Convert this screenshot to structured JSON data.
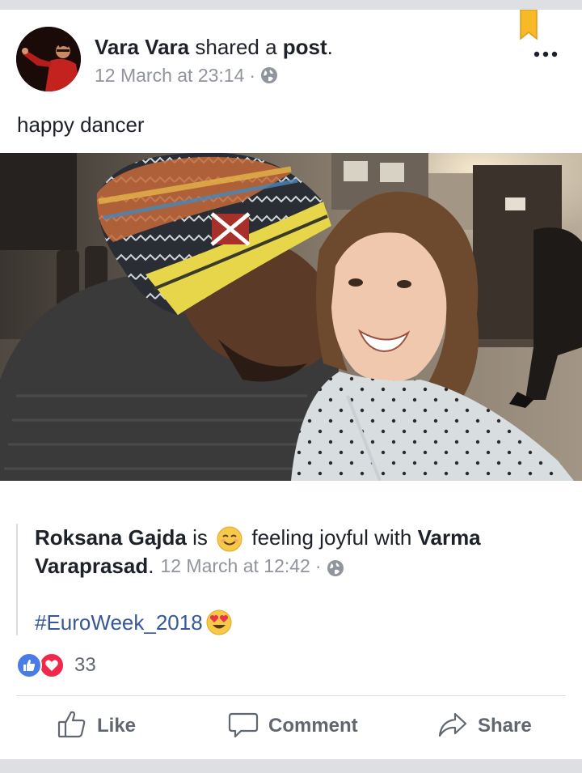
{
  "post": {
    "author": "Vara Vara",
    "action": "shared a",
    "object": "post",
    "period": ".",
    "timestamp": "12 March at 23:14",
    "separator": "·",
    "privacy_icon": "globe-icon",
    "caption": "happy dancer",
    "bookmark_icon": "bookmark-icon",
    "more_icon": "more-options-icon",
    "photo": "selfie-photo"
  },
  "shared_post": {
    "author": "Roksana Gajda",
    "is": "is",
    "feeling_emoji": "smiling-face-emoji",
    "feeling_text": "feeling joyful with",
    "tagged_line1": "Varma",
    "tagged_line2": "Varaprasad",
    "period": ".",
    "timestamp": "12 March at 12:42",
    "separator": "·",
    "privacy_icon": "globe-icon",
    "hashtag": "#EuroWeek_2018",
    "hashtag_emoji": "heart-eyes-emoji"
  },
  "reactions": {
    "icons": [
      "like-reaction-icon",
      "love-reaction-icon"
    ],
    "count": "33"
  },
  "actions": {
    "like_label": "Like",
    "comment_label": "Comment",
    "share_label": "Share"
  },
  "colors": {
    "link_blue": "#365899",
    "muted_text": "#90949c",
    "action_text": "#606770",
    "like_blue": "#4a7ce8",
    "love_red": "#f0284a",
    "bookmark_orange": "#f7b928"
  }
}
